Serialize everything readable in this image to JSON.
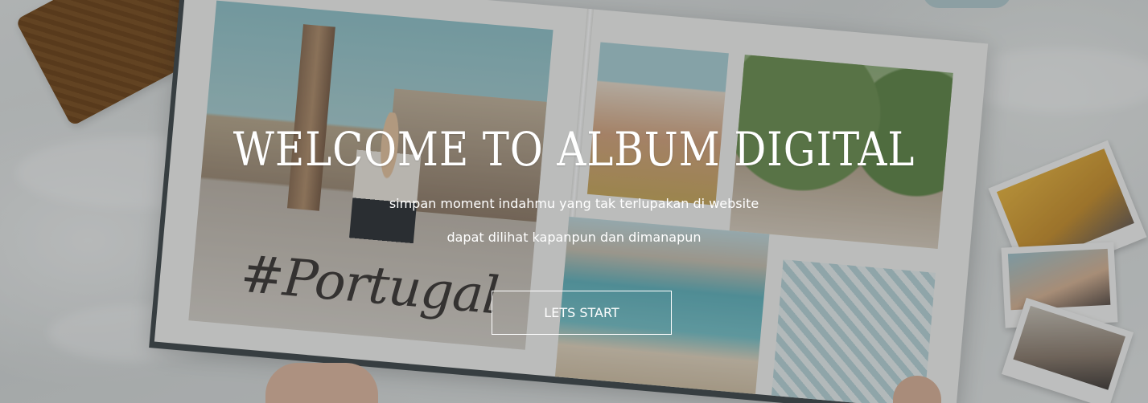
{
  "hero": {
    "title": "WELCOME TO ALBUM DIGITAL",
    "subtitle_line1": "simpan moment indahmu yang tak terlupakan di website",
    "subtitle_line2": "dapat dilihat kapanpun dan dimanapun",
    "cta_label": "LETS START",
    "background_image": {
      "hashtag_text": "#Portugal"
    }
  }
}
